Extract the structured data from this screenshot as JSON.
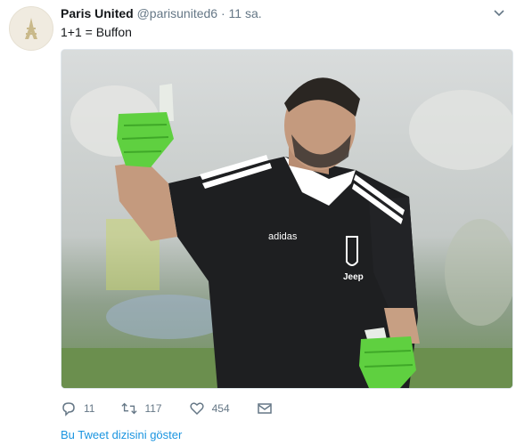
{
  "author": {
    "name": "Paris United",
    "handle": "@parisunited6",
    "separator": "·",
    "time": "11 sa."
  },
  "tweet": {
    "text": "1+1 = Buffon"
  },
  "media": {
    "jersey_brand": "adidas",
    "jersey_club": "Jeep"
  },
  "actions": {
    "replies": "11",
    "retweets": "117",
    "likes": "454"
  },
  "thread_link": "Bu Tweet dizisini göster",
  "colors": {
    "link": "#1b95e0",
    "muted": "#657786",
    "text": "#14171a",
    "glove_green": "#5fd040"
  }
}
